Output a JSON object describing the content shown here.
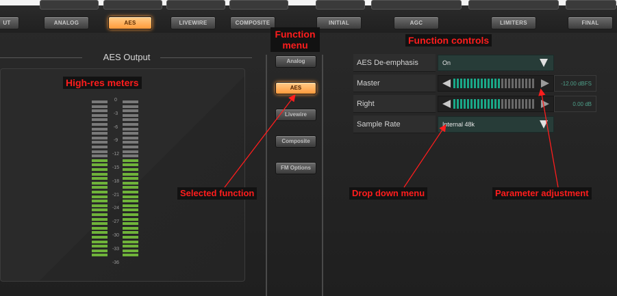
{
  "top_tabs": [
    {
      "label": "UT",
      "active": false
    },
    {
      "label": "ANALOG",
      "active": false
    },
    {
      "label": "AES",
      "active": true
    },
    {
      "label": "LIVEWIRE",
      "active": false
    },
    {
      "label": "COMPOSITE",
      "active": false
    },
    {
      "label": "INITIAL",
      "active": false
    },
    {
      "label": "AGC",
      "active": false
    },
    {
      "label": "LIMITERS",
      "active": false
    },
    {
      "label": "FINAL",
      "active": false
    }
  ],
  "meter_panel": {
    "title": "AES Output",
    "scale": [
      "0",
      "-3",
      "-6",
      "-9",
      "-12",
      "-15",
      "-18",
      "-21",
      "-24",
      "-27",
      "-30",
      "-33",
      "-36"
    ]
  },
  "function_menu": {
    "items": [
      {
        "label": "Analog",
        "active": false
      },
      {
        "label": "AES",
        "active": true
      },
      {
        "label": "Livewire",
        "active": false
      },
      {
        "label": "Composite",
        "active": false
      },
      {
        "label": "FM Options",
        "active": false
      }
    ]
  },
  "controls": [
    {
      "label": "AES De-emphasis",
      "kind": "dropdown",
      "value": "On"
    },
    {
      "label": "Master",
      "kind": "slider",
      "value": "-12.00 dBFS"
    },
    {
      "label": "Right",
      "kind": "slider",
      "value": "0.00 dB"
    },
    {
      "label": "Sample Rate",
      "kind": "dropdown",
      "value": "Internal 48k"
    }
  ],
  "annotations": {
    "function_menu": "Function menu",
    "function_controls": "Function controls",
    "high_res_meters": "High-res meters",
    "selected_function": "Selected function",
    "drop_down_menu": "Drop down menu",
    "parameter_adjustment": "Parameter adjustment"
  },
  "colors": {
    "accent_active": "#ff9a3a",
    "meter_green": "#6fb33a",
    "annotation_red": "#ff1d1d",
    "dropdown_teal": "#273c38"
  }
}
